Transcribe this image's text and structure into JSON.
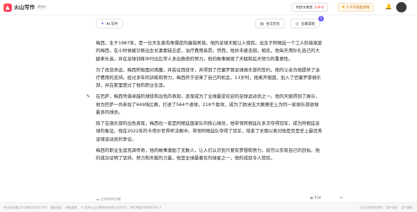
{
  "header": {
    "app_name": "火山写作",
    "beta": "Beta",
    "sync_label": "同步文章至",
    "sync_target": "头条号",
    "trial_label": "3 天不限量使用",
    "icons": {
      "logo": "volcano-logo",
      "bell": "bell-icon",
      "avatar": "user-avatar"
    }
  },
  "toolbar": {
    "ai_write": "AI 写作",
    "full_optimize": "全文优化",
    "topic_expand": "主题深挖",
    "topic_badge": "5"
  },
  "document": {
    "paragraphs": [
      "梅西，生于1987年，是一位天生患有侏儒症的瘦弱男孩。他的足球天赋让人惊叹。出生于阿根廷一个工人阶级家庭的梅西，在小时候被诊断出生长激素缺乏症，治疗费用高昂。然而，他并未被击倒，相反，他每天用针扎自己的大腿来长高，并在足球训练中付出比常人多出数倍的努力。他的故事展现了天赋和后天努力的重要性。",
      "为了改变命运，梅西积极面对病魔，并前往西班牙，并得到了巴塞罗那足球俱乐部的签约，他的父亲为他提供了治疗费用的支持。经过多年的训练和努力，梅西终于迎来了自己的机会，13岁时，他离开祖国，加入了巴塞罗那俱乐部，并在那里度过了他的职业生涯。",
      "在巴萨，梅西凭借卓越的球技和出色的表现，逐渐成为了全球最受欢迎的足球运动员之一。他的天赋得到了展示，他为巴萨一共参加了649场比赛，打进了564个进球，218个助攻，成为了欧洲五大联赛史上为同一家俱乐部进球最多的球员。",
      "除了在俱乐部的出色表现，梅西也一直是阿根廷国家队的核心球员，他带领阿根廷队多次夺得冠军，成为阿根廷足球的象征。他在2022年的卡塔尔世界杯决赛中，带领阿根廷队夺得了冠军，结束了长期以来对他是否是史上最优秀足球运动员的争论。",
      "梅西的职业生涯充满传奇，他的故事激励了无数人，让人们认识到只要有梦想和努力，就可以实现自己的目标。他的成功证明了坚持、努力和天赋的力量，他是全球最著名的球星之一，他的成就令人赞叹。"
    ]
  },
  "status": {
    "saved": "已保存到云端",
    "word_count": "514"
  },
  "footer": {
    "left": [
      "京公网安备11010802032137号",
      "服务协议",
      "隐私政策",
      "© 北京火山引擎科技有限公司2022",
      "京ICP备20018813号-2"
    ],
    "right": [
      "火山写作使用声明",
      "用户协议",
      "用户隐私"
    ]
  }
}
